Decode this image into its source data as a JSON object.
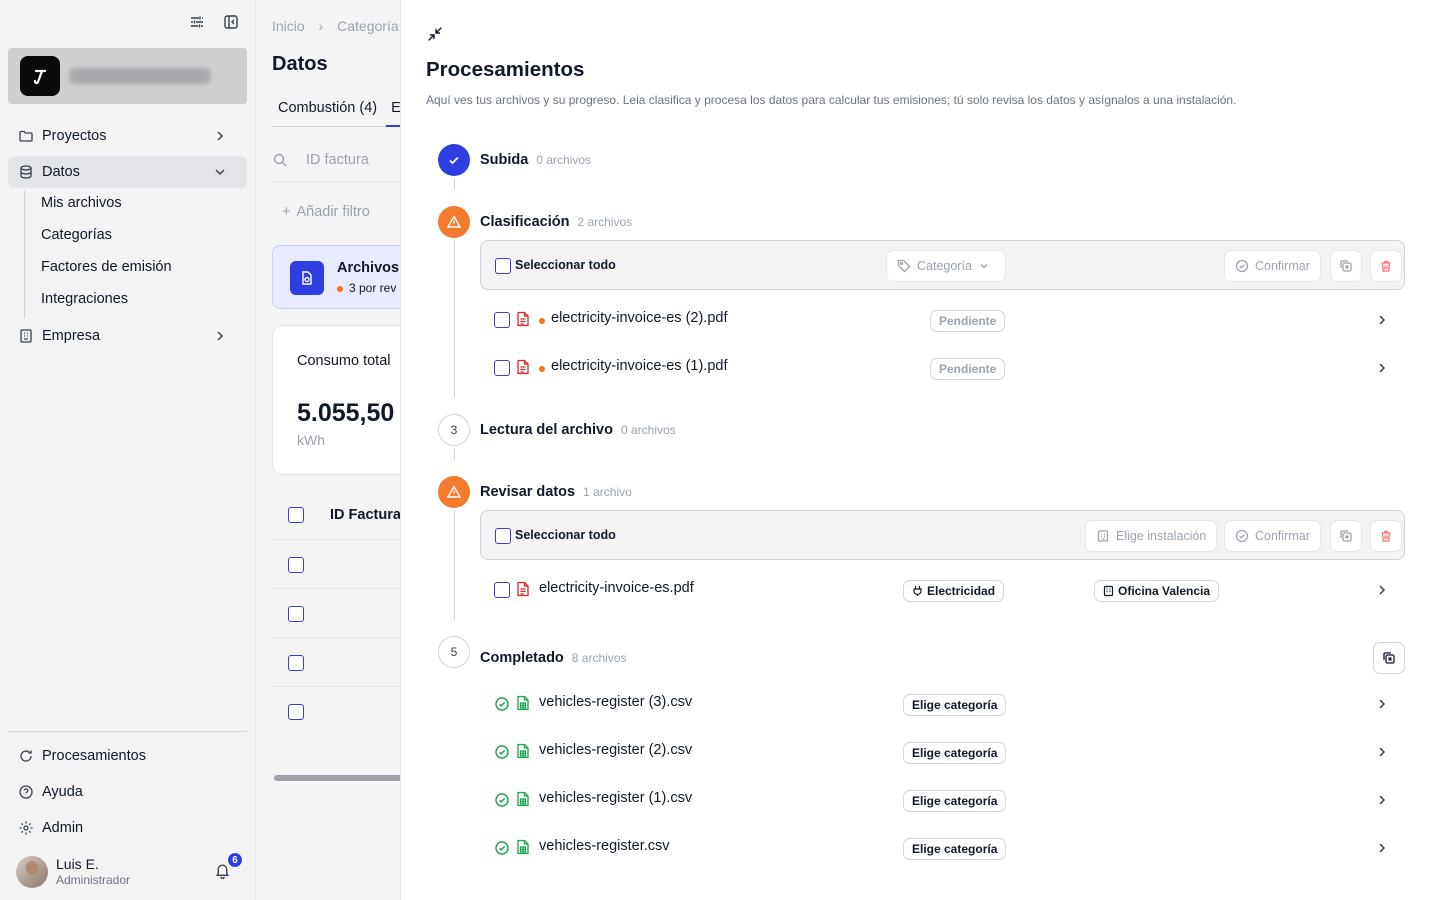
{
  "sidebar": {
    "nav": {
      "proyectos": "Proyectos",
      "datos": "Datos",
      "empresa": "Empresa",
      "procesamientos": "Procesamientos",
      "ayuda": "Ayuda",
      "admin": "Admin"
    },
    "datos_sub": [
      "Mis archivos",
      "Categorías",
      "Factores de emisión",
      "Integraciones"
    ],
    "user": {
      "name": "Luis E.",
      "role": "Administrador",
      "notifications": "6"
    }
  },
  "main": {
    "breadcrumb": [
      "Inicio",
      "›",
      "Categoría"
    ],
    "title": "Datos",
    "tab_active": "Combustión (4)",
    "tab_next": "E",
    "search_placeholder": "ID factura",
    "add_filter": "Añadir filtro",
    "card_files": {
      "title": "Archivos",
      "subtitle": "3 por rev"
    },
    "card_consumption": {
      "label": "Consumo total",
      "value": "5.055,50",
      "unit": "kWh"
    },
    "table_header": "ID Factura"
  },
  "drawer": {
    "title": "Procesamientos",
    "subtitle": "Aquí ves tus archivos y su progreso. Leia clasifica y procesa los datos para calcular tus emisiones; tú solo revisa los datos y asígnalos a una instalación.",
    "steps": {
      "subida": {
        "label": "Subida",
        "count": "0 archivos"
      },
      "clasificacion": {
        "label": "Clasificación",
        "count": "2 archivos",
        "select_all": "Seleccionar todo",
        "category_btn": "Categoría",
        "confirm_btn": "Confirmar",
        "files": [
          {
            "name": "electricity-invoice-es (2).pdf",
            "status": "Pendiente"
          },
          {
            "name": "electricity-invoice-es (1).pdf",
            "status": "Pendiente"
          }
        ]
      },
      "lectura": {
        "number": "3",
        "label": "Lectura del archivo",
        "count": "0 archivos"
      },
      "revisar": {
        "label": "Revisar datos",
        "count": "1 archivo",
        "select_all": "Seleccionar todo",
        "facility_btn": "Elige instalación",
        "confirm_btn": "Confirmar",
        "files": [
          {
            "name": "electricity-invoice-es.pdf",
            "category": "Electricidad",
            "facility": "Oficina Valencia"
          }
        ]
      },
      "completado": {
        "number": "5",
        "label": "Completado",
        "count": "8 archivos",
        "files": [
          {
            "name": "vehicles-register (3).csv",
            "category": "Elige categoría"
          },
          {
            "name": "vehicles-register (2).csv",
            "category": "Elige categoría"
          },
          {
            "name": "vehicles-register (1).csv",
            "category": "Elige categoría"
          },
          {
            "name": "vehicles-register.csv",
            "category": "Elige categoría"
          }
        ]
      }
    }
  },
  "colors": {
    "accent": "#2f3ee0",
    "warning": "#f47a2d",
    "success": "#16a34a",
    "danger": "#ef4444"
  }
}
